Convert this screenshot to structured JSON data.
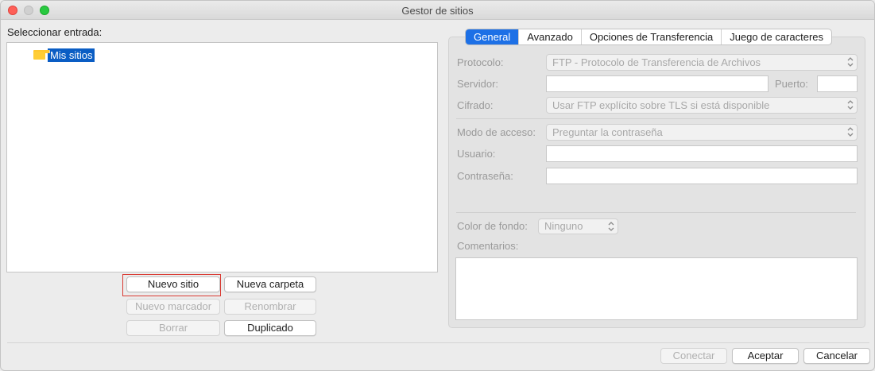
{
  "window": {
    "title": "Gestor de sitios"
  },
  "site_list": {
    "label": "Seleccionar entrada:",
    "items": [
      {
        "label": "Mis sitios",
        "icon": "folder-icon",
        "selected": true
      }
    ]
  },
  "site_buttons": {
    "new_site": "Nuevo sitio",
    "new_folder": "Nueva carpeta",
    "new_bookmark": "Nuevo marcador",
    "rename": "Renombrar",
    "delete": "Borrar",
    "duplicate": "Duplicado"
  },
  "tabs": [
    {
      "label": "General",
      "active": true
    },
    {
      "label": "Avanzado",
      "active": false
    },
    {
      "label": "Opciones de Transferencia",
      "active": false
    },
    {
      "label": "Juego de caracteres",
      "active": false
    }
  ],
  "general": {
    "protocol_label": "Protocolo:",
    "protocol_value": "FTP - Protocolo de Transferencia de Archivos",
    "server_label": "Servidor:",
    "server_value": "",
    "port_label": "Puerto:",
    "port_value": "",
    "encryption_label": "Cifrado:",
    "encryption_value": "Usar FTP explícito sobre TLS si está disponible",
    "access_mode_label": "Modo de acceso:",
    "access_mode_value": "Preguntar la contraseña",
    "user_label": "Usuario:",
    "user_value": "",
    "password_label": "Contraseña:",
    "password_value": "",
    "bg_color_label": "Color de fondo:",
    "bg_color_value": "Ninguno",
    "comments_label": "Comentarios:",
    "comments_value": ""
  },
  "footer": {
    "connect": "Conectar",
    "accept": "Aceptar",
    "cancel": "Cancelar"
  },
  "colors": {
    "accent": "#1d70e6",
    "selection": "#0a5dc4",
    "highlight_border": "#d93a32"
  }
}
